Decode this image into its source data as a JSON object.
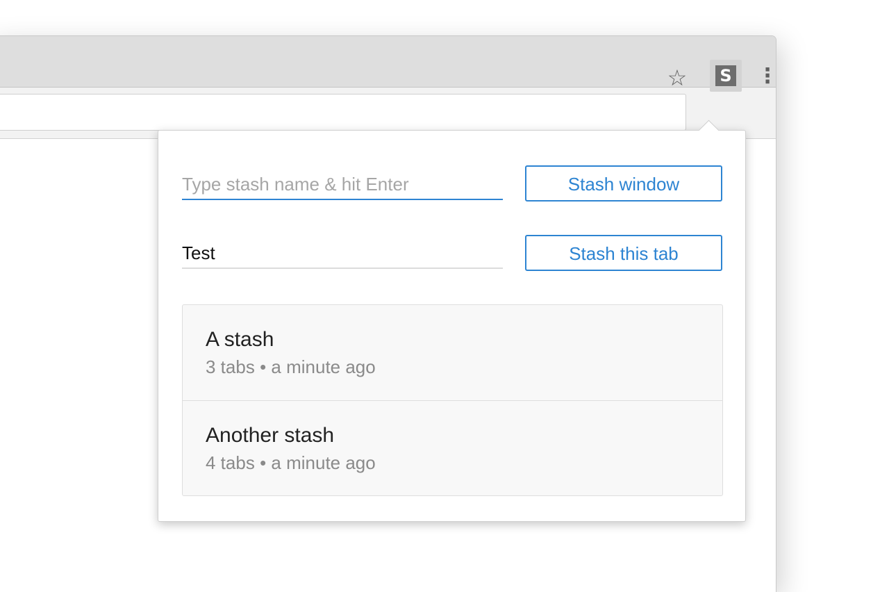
{
  "browser": {
    "star_glyph": "☆",
    "menu_glyph": "⋮",
    "extension_letter": "S"
  },
  "popup": {
    "window_input": {
      "value": "",
      "placeholder": "Type stash name & hit Enter"
    },
    "stash_window_label": "Stash window",
    "tab_input": {
      "value": "Test",
      "placeholder": ""
    },
    "stash_tab_label": "Stash this tab",
    "stashes": [
      {
        "name": "A stash",
        "tabs": "3 tabs",
        "separator": "•",
        "time": "a minute ago"
      },
      {
        "name": "Another stash",
        "tabs": "4 tabs",
        "separator": "•",
        "time": "a minute ago"
      }
    ]
  },
  "colors": {
    "accent": "#2d84d2",
    "placeholder": "#a6a6a6",
    "muted_text": "#8a8a8a"
  }
}
